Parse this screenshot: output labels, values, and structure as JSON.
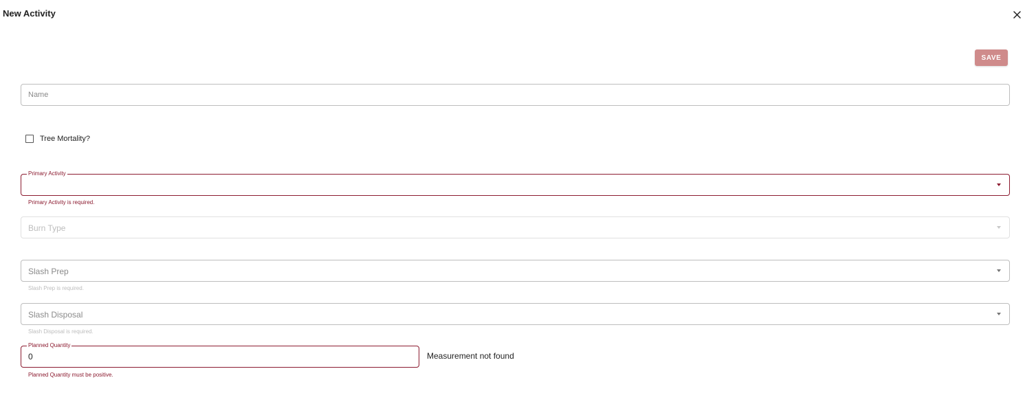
{
  "dialog": {
    "title": "New Activity",
    "close_icon": "close-icon"
  },
  "toolbar": {
    "save_label": "SAVE",
    "save_color": "#cf8b8b"
  },
  "form": {
    "name": {
      "placeholder": "Name",
      "value": ""
    },
    "tree_mortality": {
      "label": "Tree Mortality?",
      "checked": false
    },
    "primary_activity": {
      "label": "Primary Activity",
      "value": "",
      "error": "Primary Activity is required."
    },
    "burn_type": {
      "placeholder": "Burn Type",
      "disabled": true
    },
    "slash_prep": {
      "placeholder": "Slash Prep",
      "helper": "Slash Prep is required."
    },
    "slash_disposal": {
      "placeholder": "Slash Disposal",
      "helper": "Slash Disposal is required."
    },
    "planned_quantity": {
      "label": "Planned Quantity",
      "value": "0",
      "error": "Planned Quantity must be positive.",
      "unit_text": "Measurement not found"
    }
  },
  "colors": {
    "error": "#8b1a2f",
    "border": "#bdbdbd"
  }
}
